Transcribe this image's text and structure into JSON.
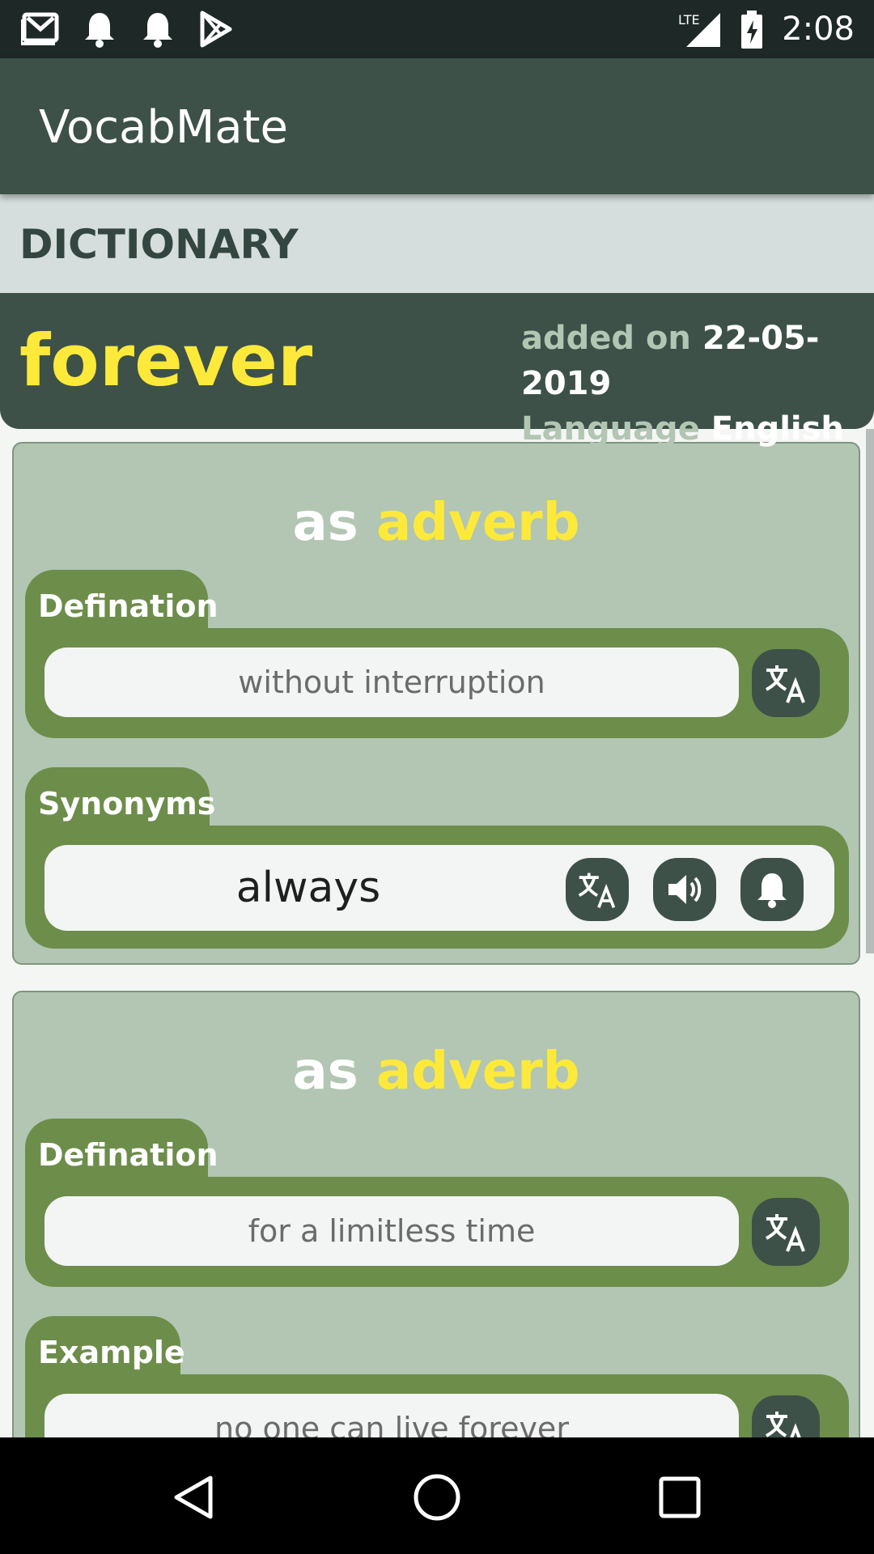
{
  "status_bar": {
    "time": "2:08",
    "network": "LTE",
    "left_icons": [
      "gmail-icon",
      "bell-icon",
      "bell-icon",
      "play-store-icon"
    ],
    "right_icons": [
      "lte-signal-icon",
      "battery-charging-icon"
    ]
  },
  "app": {
    "title": "VocabMate"
  },
  "section": {
    "title": "DICTIONARY"
  },
  "word": {
    "text": "forever",
    "added_label": "added on",
    "added_value": "22-05-2019",
    "language_label": "Language",
    "language_value": "English"
  },
  "senses": [
    {
      "as_label": "as",
      "pos": "adverb",
      "definition_label": "Defination",
      "definition": "without interruption",
      "secondary_label": "Synonyms",
      "secondary_value": "always"
    },
    {
      "as_label": "as",
      "pos": "adverb",
      "definition_label": "Defination",
      "definition": "for a limitless time",
      "secondary_label": "Example",
      "secondary_value": "no one can live forever"
    }
  ],
  "icons": {
    "translate": "translate-icon",
    "speaker": "speaker-icon",
    "bell": "bell-icon"
  },
  "navigation": [
    "back-icon",
    "home-icon",
    "recents-icon"
  ],
  "colors": {
    "app_bar": "#3d5149",
    "accent_yellow": "#fde93a",
    "card": "#b2c6b3",
    "panel": "#6d8d4b"
  }
}
